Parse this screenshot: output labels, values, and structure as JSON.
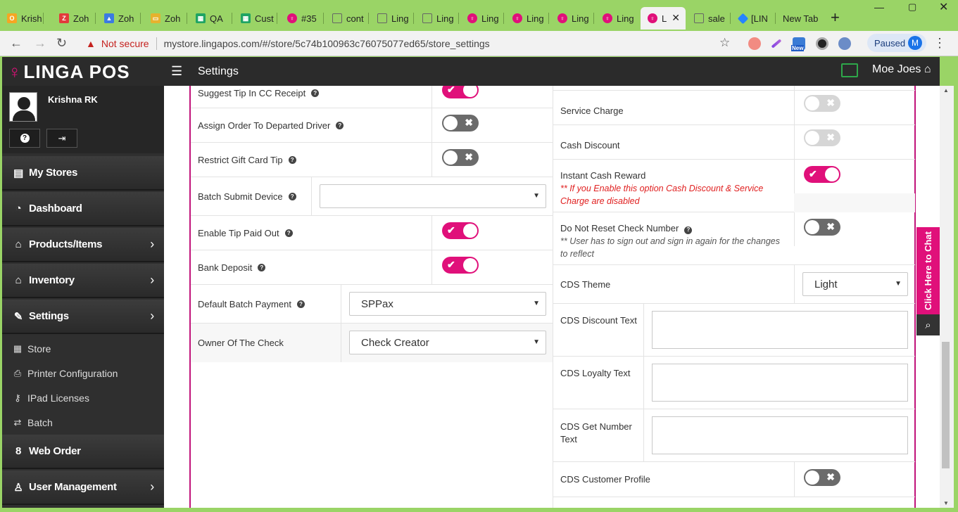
{
  "browser": {
    "tabs": [
      {
        "title": "Krish",
        "icon": "outlook-icon",
        "color": "#f5a623"
      },
      {
        "title": "Zoh",
        "icon": "zoho-icon",
        "color": "#e23b3b"
      },
      {
        "title": "Zoh",
        "icon": "zoho-apps-icon",
        "color": "#3b7be2"
      },
      {
        "title": "Zoh",
        "icon": "zoho-folder-icon",
        "color": "#e6b22e"
      },
      {
        "title": "QA",
        "icon": "sheet-icon",
        "color": "#1fa463"
      },
      {
        "title": "Cust",
        "icon": "sheet-icon",
        "color": "#1fa463"
      },
      {
        "title": "#35",
        "icon": "linga-icon",
        "color": "#e0107a"
      },
      {
        "title": "cont",
        "icon": "doc-icon",
        "color": "#666666"
      },
      {
        "title": "Ling",
        "icon": "doc-icon",
        "color": "#666666"
      },
      {
        "title": "Ling",
        "icon": "doc-icon",
        "color": "#666666"
      },
      {
        "title": "Ling",
        "icon": "linga-icon",
        "color": "#e0107a"
      },
      {
        "title": "Ling",
        "icon": "linga-icon",
        "color": "#e0107a"
      },
      {
        "title": "Ling",
        "icon": "linga-icon",
        "color": "#e0107a"
      },
      {
        "title": "Ling",
        "icon": "linga-icon",
        "color": "#e0107a"
      },
      {
        "title": "L",
        "icon": "linga-icon",
        "color": "#e0107a",
        "active": true
      },
      {
        "title": "sale",
        "icon": "doc-icon",
        "color": "#666666"
      },
      {
        "title": "[LIN",
        "icon": "jira-icon",
        "color": "#2684ff"
      },
      {
        "title": "New Tab",
        "icon": "",
        "color": ""
      }
    ],
    "new_tab_glyph": "+",
    "not_secure": "Not secure",
    "url": "mystore.lingapos.com/#/store/5c74b100963c76075077ed65/store_settings",
    "profile_status": "Paused",
    "profile_initial": "M",
    "ext_new_badge": "New"
  },
  "app": {
    "logo_text": "LINGA POS",
    "page_title": "Settings",
    "store_name": "Moe Joes",
    "user_name": "Krishna RK",
    "help_glyph": "?",
    "logout_glyph": "⇥"
  },
  "sidebar": {
    "menus": [
      {
        "label": "My Stores",
        "icon": "store-icon",
        "glyph": "▤",
        "chevron": false
      },
      {
        "label": "Dashboard",
        "icon": "dashboard-icon",
        "glyph": "◔",
        "chevron": false
      },
      {
        "label": "Products/Items",
        "icon": "basket-icon",
        "glyph": "⌂",
        "chevron": true
      },
      {
        "label": "Inventory",
        "icon": "inventory-basket-icon",
        "glyph": "⌂",
        "chevron": true
      },
      {
        "label": "Settings",
        "icon": "wrench-icon",
        "glyph": "✎",
        "chevron": true
      }
    ],
    "submenus": [
      {
        "label": "Store",
        "icon": "store-sub-icon",
        "glyph": "▦"
      },
      {
        "label": "Printer Configuration",
        "icon": "printer-icon",
        "glyph": "⎙"
      },
      {
        "label": "IPad Licenses",
        "icon": "key-icon",
        "glyph": "⚷"
      },
      {
        "label": "Batch",
        "icon": "exchange-icon",
        "glyph": "⇄"
      }
    ],
    "menus_bottom": [
      {
        "label": "Web Order",
        "icon": "web-order-icon",
        "glyph": "8",
        "chevron": false
      },
      {
        "label": "User Management",
        "icon": "users-icon",
        "glyph": "♙",
        "chevron": true
      }
    ],
    "chevron_glyph": "›"
  },
  "left_settings": [
    {
      "label": "Suggest Tip In CC Receipt",
      "type": "toggle",
      "state": "on"
    },
    {
      "label": "Assign Order To Departed Driver",
      "type": "toggle",
      "state": "off"
    },
    {
      "label": "Restrict Gift Card Tip",
      "type": "toggle",
      "state": "off"
    },
    {
      "label": "Batch Submit Device",
      "type": "select",
      "value": ""
    },
    {
      "label": "Enable Tip Paid Out",
      "type": "toggle",
      "state": "on"
    },
    {
      "label": "Bank Deposit",
      "type": "toggle",
      "state": "on"
    },
    {
      "label": "Default Batch Payment",
      "type": "select",
      "value": "SPPax"
    },
    {
      "label": "Owner Of The Check",
      "type": "select",
      "value": "Check Creator"
    }
  ],
  "right_settings": [
    {
      "label": "Service Charge",
      "type": "toggle",
      "state": "disabled"
    },
    {
      "label": "Cash Discount",
      "type": "toggle",
      "state": "disabled"
    },
    {
      "label": "Instant Cash Reward",
      "type": "toggle",
      "state": "on",
      "note": "** If you Enable this option Cash Discount & Service Charge are disabled"
    },
    {
      "label": "Do Not Reset Check Number",
      "type": "toggle",
      "state": "off",
      "note": "** User has to sign out and sign in again for the changes to reflect"
    },
    {
      "label": "CDS Theme",
      "type": "select",
      "value": "Light"
    },
    {
      "label": "CDS Discount Text",
      "type": "textarea",
      "value": ""
    },
    {
      "label": "CDS Loyalty Text",
      "type": "textarea",
      "value": ""
    },
    {
      "label": "CDS Get Number Text",
      "type": "textarea",
      "value": ""
    },
    {
      "label": "CDS Customer Profile",
      "type": "toggle",
      "state": "off"
    }
  ],
  "chat": {
    "label": "Click Here to Chat"
  },
  "colors": {
    "accent": "#e0107a",
    "sidebar": "#2f2f2f",
    "header": "#2b2b2b",
    "chrome_frame": "#9ad466"
  }
}
